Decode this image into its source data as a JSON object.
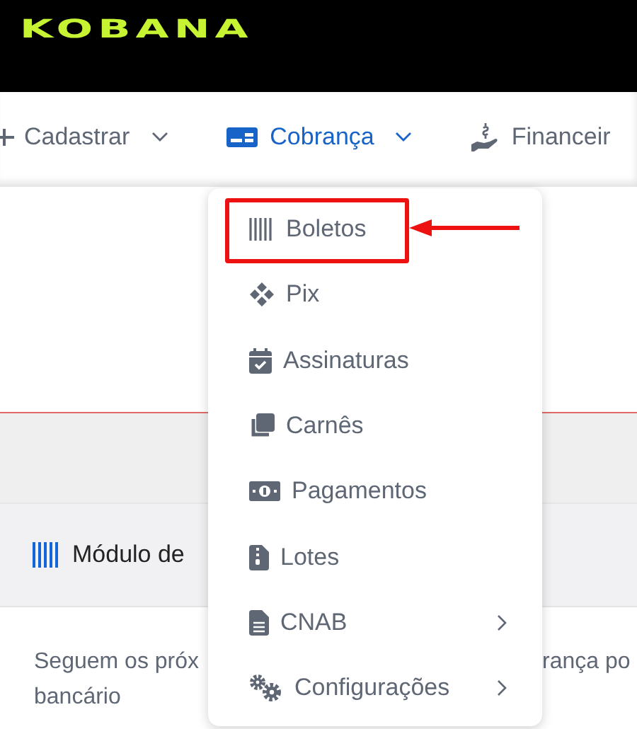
{
  "logo": {
    "text": "KOBANA"
  },
  "nav": [
    {
      "label": "Cadastrar",
      "selected": false,
      "dropdown": true
    },
    {
      "label": "Cobrança",
      "selected": true,
      "dropdown": true
    },
    {
      "label": "Financeir",
      "selected": false,
      "dropdown": false
    }
  ],
  "menu": [
    {
      "label": "Boletos",
      "submenu": false,
      "annotated": true
    },
    {
      "label": "Pix",
      "submenu": false,
      "annotated": false
    },
    {
      "label": "Assinaturas",
      "submenu": false,
      "annotated": false
    },
    {
      "label": "Carnês",
      "submenu": false,
      "annotated": false
    },
    {
      "label": "Pagamentos",
      "submenu": false,
      "annotated": false
    },
    {
      "label": "Lotes",
      "submenu": false,
      "annotated": false
    },
    {
      "label": "CNAB",
      "submenu": true,
      "annotated": false
    },
    {
      "label": "Configurações",
      "submenu": true,
      "annotated": false
    }
  ],
  "card": {
    "title": "Módulo de",
    "text_left": [
      "Seguem os próx",
      "bancário"
    ],
    "text_right": "rança po"
  }
}
